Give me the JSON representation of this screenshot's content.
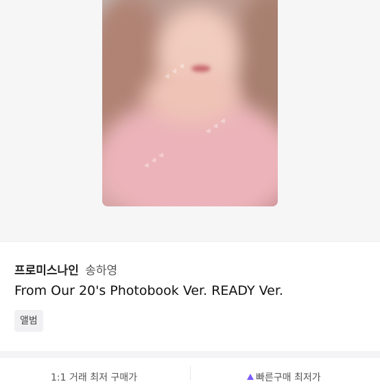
{
  "product": {
    "group": "프로미스나인",
    "member": "송하영",
    "title": "From Our 20's Photobook Ver. READY Ver.",
    "category_tag": "앨범"
  },
  "price_bar": {
    "left_label": "1:1 거래 최저 구매가",
    "right_label": "빠른구매 최저가"
  },
  "colors": {
    "accent": "#7c5cff",
    "hero_bg": "#f6f6f7"
  }
}
